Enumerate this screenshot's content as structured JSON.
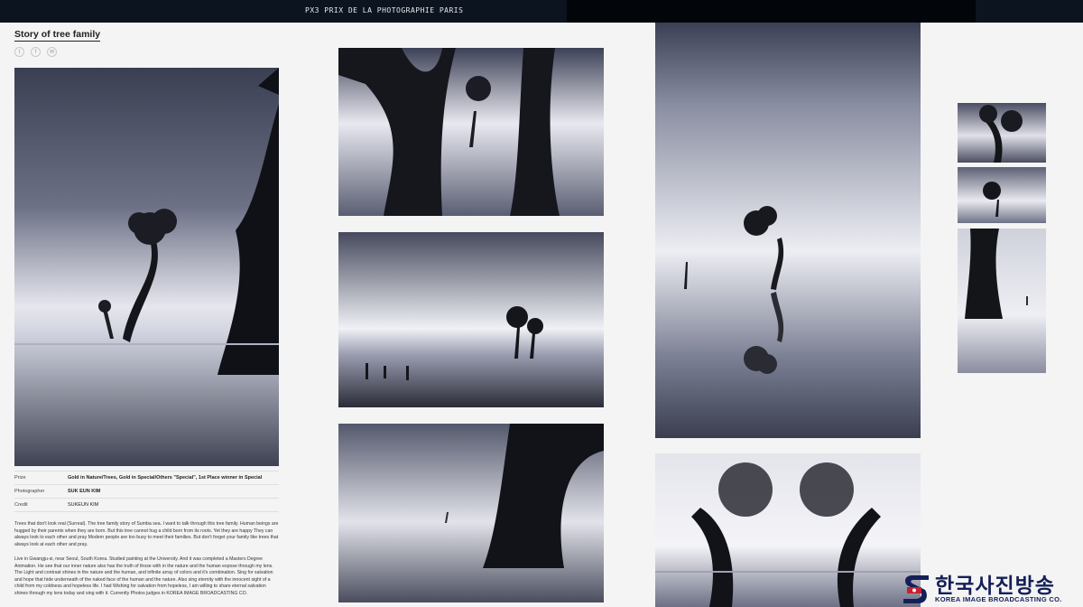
{
  "header": {
    "brand": "PX3 PRIX DE LA PHOTOGRAPHIE PARIS"
  },
  "article": {
    "title": "Story of tree family",
    "share_icons": [
      "twitter-icon",
      "facebook-icon",
      "email-icon"
    ]
  },
  "details": [
    {
      "label": "Prize",
      "value": "Gold in Nature/Trees, Gold in Special/Others \"Special\", 1st Place winner in Special",
      "bold": true
    },
    {
      "label": "Photographer",
      "value": "SUK EUN KIM",
      "bold": true
    },
    {
      "label": "Credit",
      "value": "SUKEUN KIM",
      "bold": false
    }
  ],
  "description": [
    "Trees that don't look real (Surreal). The tree family story of Sumba sea. I want to talk through this tree family. Human beings are hugged by their parents when they are born. But this tree cannot hug a child born from its roots. Yet they are happy They can always look to each other and pray Modern people are too busy to meet their families. But don't forget your family like trees that always look at each other and pray.",
    "Live in Gwangju-si, near Seoul, South Korea. Studied painting at the University. And it was completed a Masters Degree Animation. He see that our inner nature also has the truth of those with in the nature and the human expose through my lens. The Light and contrast shines in the nature and the human, and infinite array of colors and it's combination. Sing for salvation and hope that hide underneath of the naked face of the human and the nature. Also sing eternity with the innocent sight of a child from my coldness and hopeless life. I had Wishing for salvation from hopeless, I am willing to share eternal salvation shines through my lens today and sing with it. Currently Photos judges in KOREA IMAGE BROADCASTING CO."
  ],
  "watermark": {
    "korean": "한국사진방송",
    "english": "KOREA IMAGE BROADCASTING CO."
  },
  "colors": {
    "topbar": "#0c1420",
    "background": "#f4f4f4",
    "logo_navy": "#151f57",
    "logo_red": "#c8202f"
  }
}
